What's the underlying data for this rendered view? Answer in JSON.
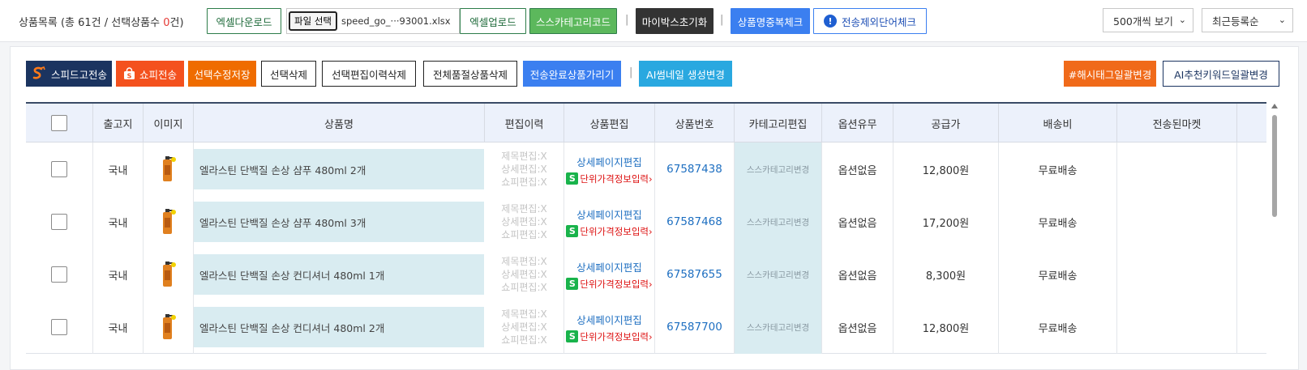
{
  "header": {
    "title_prefix": "상품목록 (총 61건 / 선택상품수 ",
    "selected_count": "0",
    "title_suffix": "건)",
    "buttons": {
      "excel_download": "엑셀다운로드",
      "file_select": "파일 선택",
      "file_name": "speed_go_···93001.xlsx",
      "excel_upload": "엑셀업로드",
      "ss_category_code": "스스카테고리코드",
      "mybox_reset": "마이박스초기화",
      "dup_name_check": "상품명중복체크",
      "exclude_word_check": "전송제외단어체크"
    },
    "separator": "|",
    "page_size": "500개씩 보기",
    "sort": "최근등록순"
  },
  "actions": {
    "speedgo_send": "스피드고전송",
    "shopee_send": "쇼피전송",
    "save_edits": "선택수정저장",
    "delete_selected": "선택삭제",
    "delete_edit_history": "선택편집이력삭제",
    "delete_all_soldout": "전체품절상품삭제",
    "hide_sent": "전송완료상품가리기",
    "ai_thumbnail": "AI썸네일 생성변경",
    "hashtag_bulk": "#해시태그일괄변경",
    "ai_keyword_bulk": "AI추천키워드일괄변경"
  },
  "table": {
    "columns": [
      "출고지",
      "이미지",
      "상품명",
      "편집이력",
      "상품편집",
      "상품번호",
      "카테고리편집",
      "옵션유무",
      "공급가",
      "배송비",
      "전송된마켓"
    ],
    "edit_history": [
      "제목편집:X",
      "상세편집:X",
      "쇼피편집:X"
    ],
    "detail_edit_link": "상세페이지편집",
    "unit_price_badge": "S",
    "unit_price_text": "단위가격정보입력",
    "unit_price_arrow": "›",
    "category_change": "스스카테고리변경",
    "rows": [
      {
        "origin": "국내",
        "name": "엘라스틴 단백질 손상 샴푸 480ml 2개",
        "product_no": "67587438",
        "option": "옵션없음",
        "price": "12,800원",
        "shipping": "무료배송",
        "market": ""
      },
      {
        "origin": "국내",
        "name": "엘라스틴 단백질 손상 샴푸 480ml 3개",
        "product_no": "67587468",
        "option": "옵션없음",
        "price": "17,200원",
        "shipping": "무료배송",
        "market": ""
      },
      {
        "origin": "국내",
        "name": "엘라스틴 단백질 손상 컨디셔너 480ml 1개",
        "product_no": "67587655",
        "option": "옵션없음",
        "price": "8,300원",
        "shipping": "무료배송",
        "market": ""
      },
      {
        "origin": "국내",
        "name": "엘라스틴 단백질 손상 컨디셔너 480ml 2개",
        "product_no": "67587700",
        "option": "옵션없음",
        "price": "12,800원",
        "shipping": "무료배송",
        "market": ""
      }
    ]
  },
  "colors": {
    "accent_red": "#e53935",
    "link_blue": "#1e6fc1",
    "highlight_cell": "#d9ecf1"
  }
}
